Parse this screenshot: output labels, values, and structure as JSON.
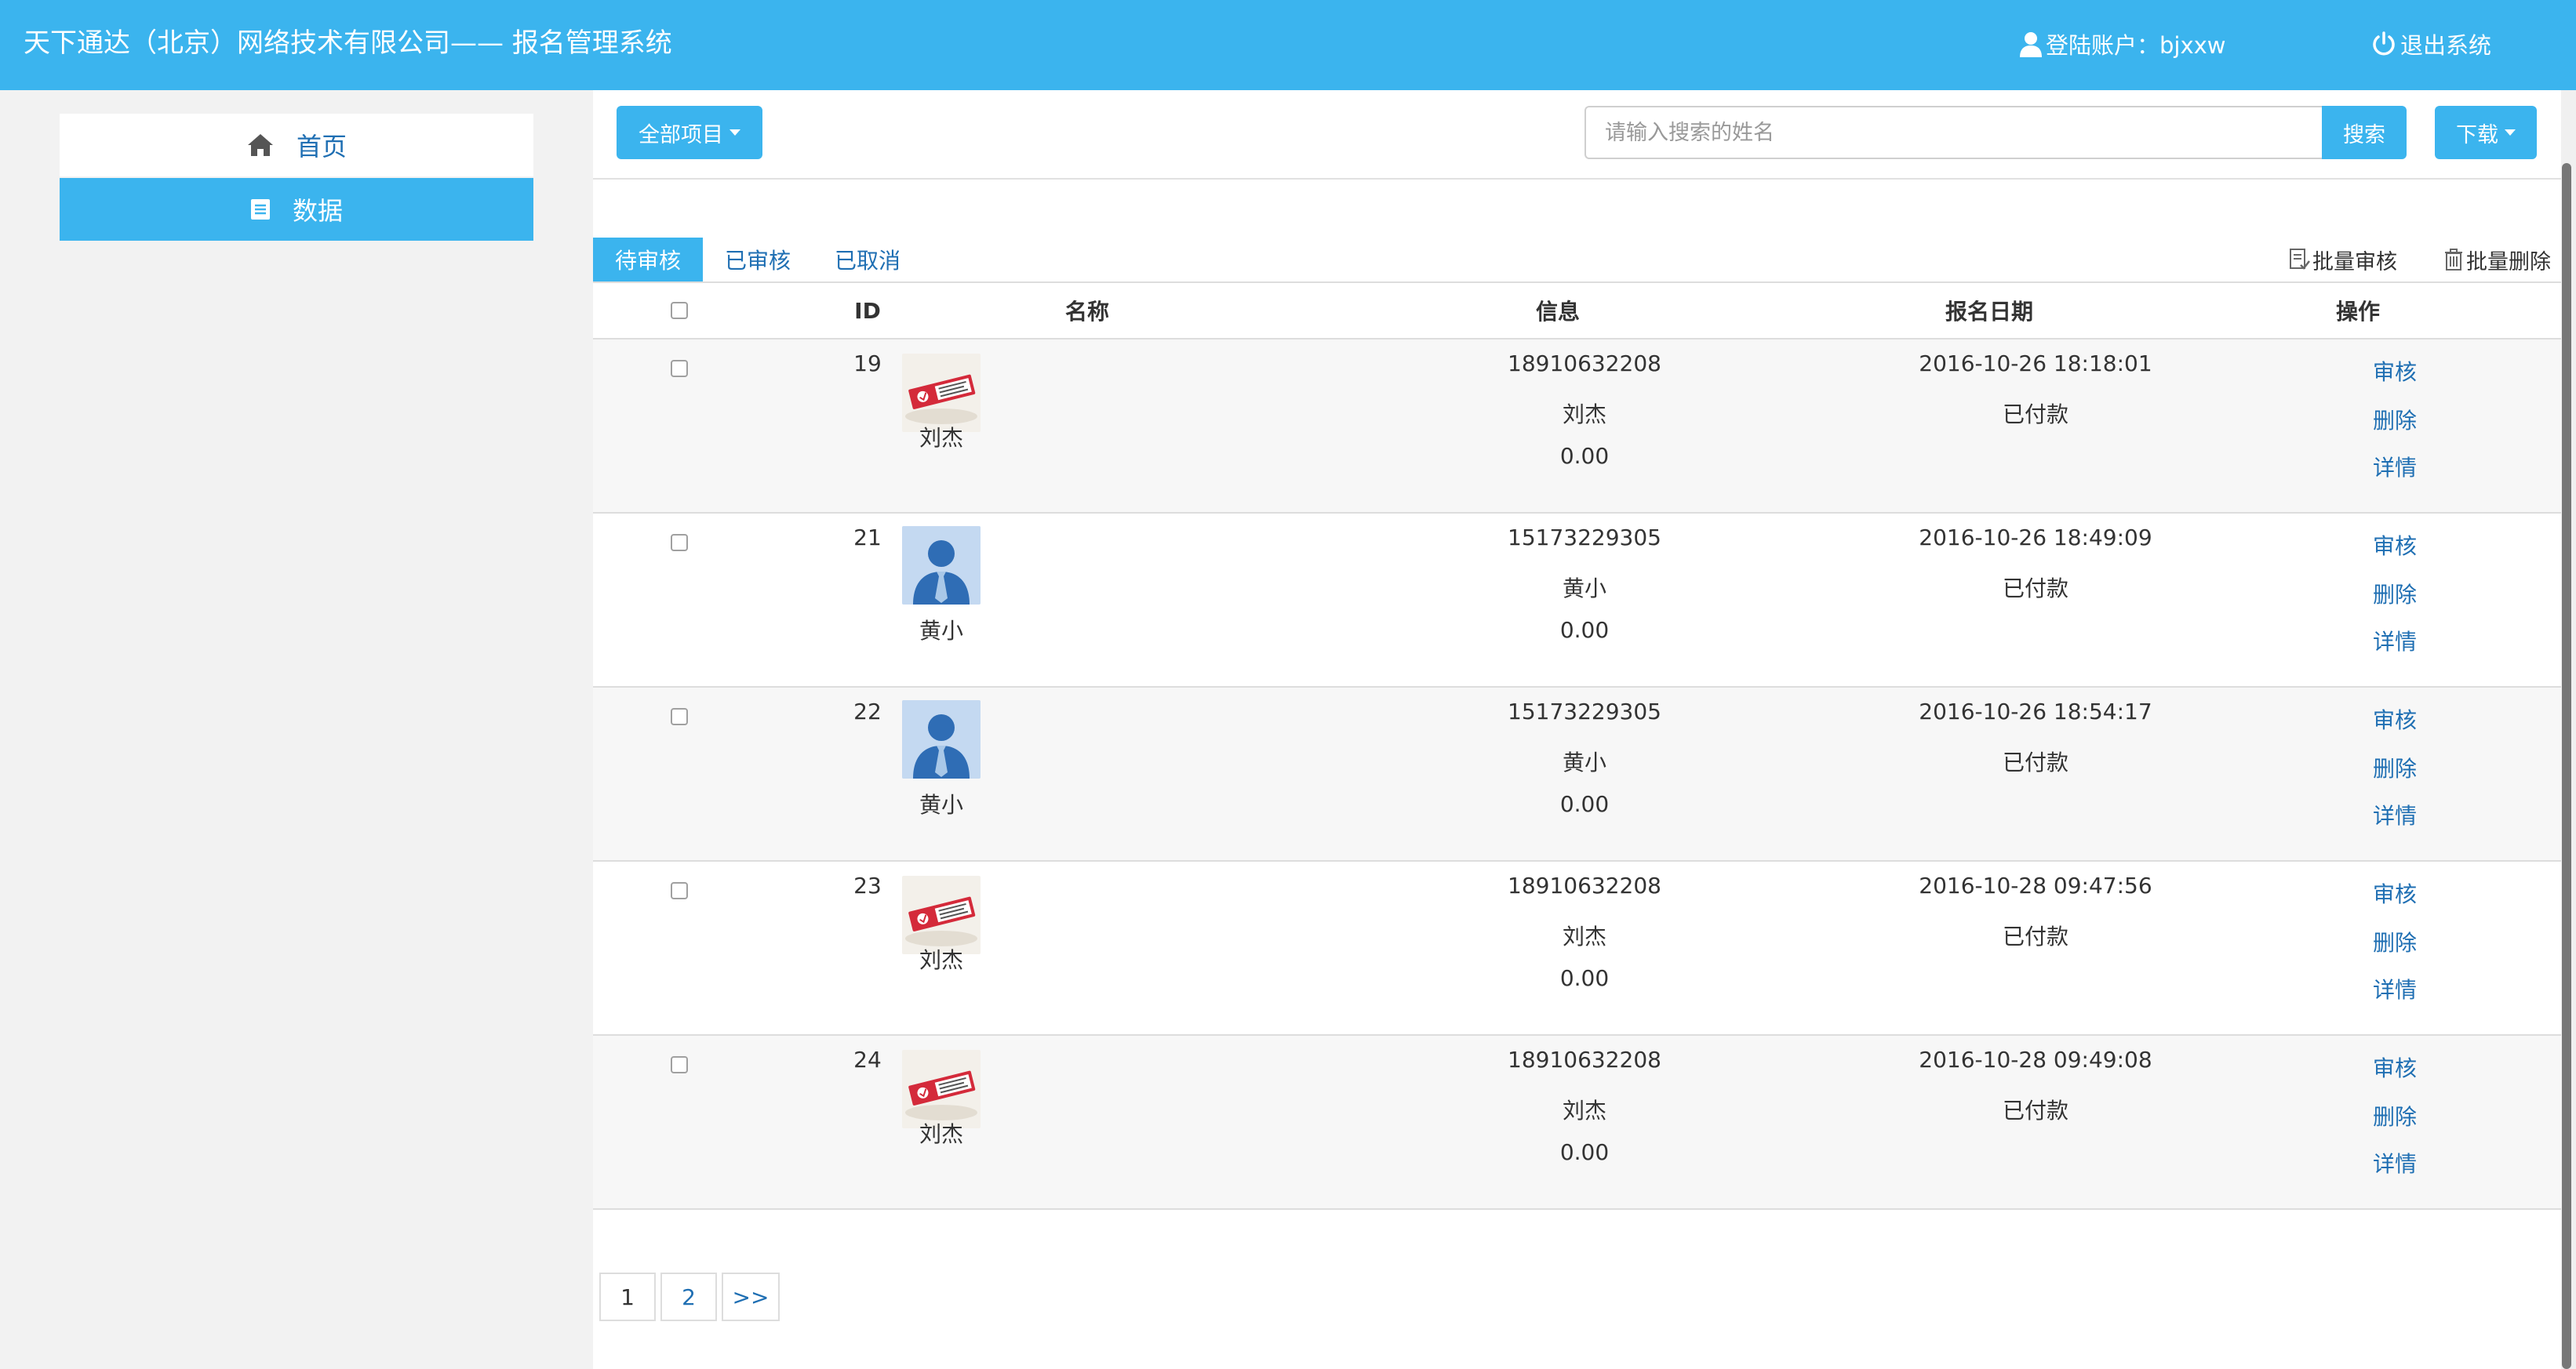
{
  "header": {
    "title": "天下通达（北京）网络技术有限公司—— 报名管理系统",
    "account_label": "登陆账户：bjxxw",
    "logout_label": "退出系统",
    "bg_color": "#3bb4ee"
  },
  "sidebar": {
    "items": [
      {
        "label": "首页",
        "icon": "home-icon",
        "active": false
      },
      {
        "label": "数据",
        "icon": "list-icon",
        "active": true
      }
    ]
  },
  "toolbar": {
    "all_projects_label": "全部项目",
    "search_placeholder": "请输入搜索的姓名",
    "search_value": "",
    "search_button": "搜索",
    "download_label": "下载"
  },
  "tabs": [
    {
      "label": "待审核",
      "active": true
    },
    {
      "label": "已审核",
      "active": false
    },
    {
      "label": "已取消",
      "active": false
    }
  ],
  "batch": {
    "approve_label": "批量审核",
    "delete_label": "批量删除"
  },
  "table": {
    "headers": {
      "id": "ID",
      "name": "名称",
      "info": "信息",
      "date": "报名日期",
      "action": "操作"
    },
    "rows": [
      {
        "id": "19",
        "avatar": "product-thumbnail",
        "name": "刘杰",
        "phone": "18910632208",
        "info_name": "刘杰",
        "amount": "0.00",
        "date": "2016-10-26 18:18:01",
        "status": "已付款",
        "op_approve": "审核",
        "op_delete": "删除",
        "op_detail": "详情"
      },
      {
        "id": "21",
        "avatar": "person-avatar",
        "name": "黄小",
        "phone": "15173229305",
        "info_name": "黄小",
        "amount": "0.00",
        "date": "2016-10-26 18:49:09",
        "status": "已付款",
        "op_approve": "审核",
        "op_delete": "删除",
        "op_detail": "详情"
      },
      {
        "id": "22",
        "avatar": "person-avatar",
        "name": "黄小",
        "phone": "15173229305",
        "info_name": "黄小",
        "amount": "0.00",
        "date": "2016-10-26 18:54:17",
        "status": "已付款",
        "op_approve": "审核",
        "op_delete": "删除",
        "op_detail": "详情"
      },
      {
        "id": "23",
        "avatar": "product-thumbnail",
        "name": "刘杰",
        "phone": "18910632208",
        "info_name": "刘杰",
        "amount": "0.00",
        "date": "2016-10-28 09:47:56",
        "status": "已付款",
        "op_approve": "审核",
        "op_delete": "删除",
        "op_detail": "详情"
      },
      {
        "id": "24",
        "avatar": "product-thumbnail",
        "name": "刘杰",
        "phone": "18910632208",
        "info_name": "刘杰",
        "amount": "0.00",
        "date": "2016-10-28 09:49:08",
        "status": "已付款",
        "op_approve": "审核",
        "op_delete": "删除",
        "op_detail": "详情"
      }
    ]
  },
  "pagination": {
    "pages": [
      "1",
      "2"
    ],
    "next_label": ">>",
    "current": "1"
  }
}
